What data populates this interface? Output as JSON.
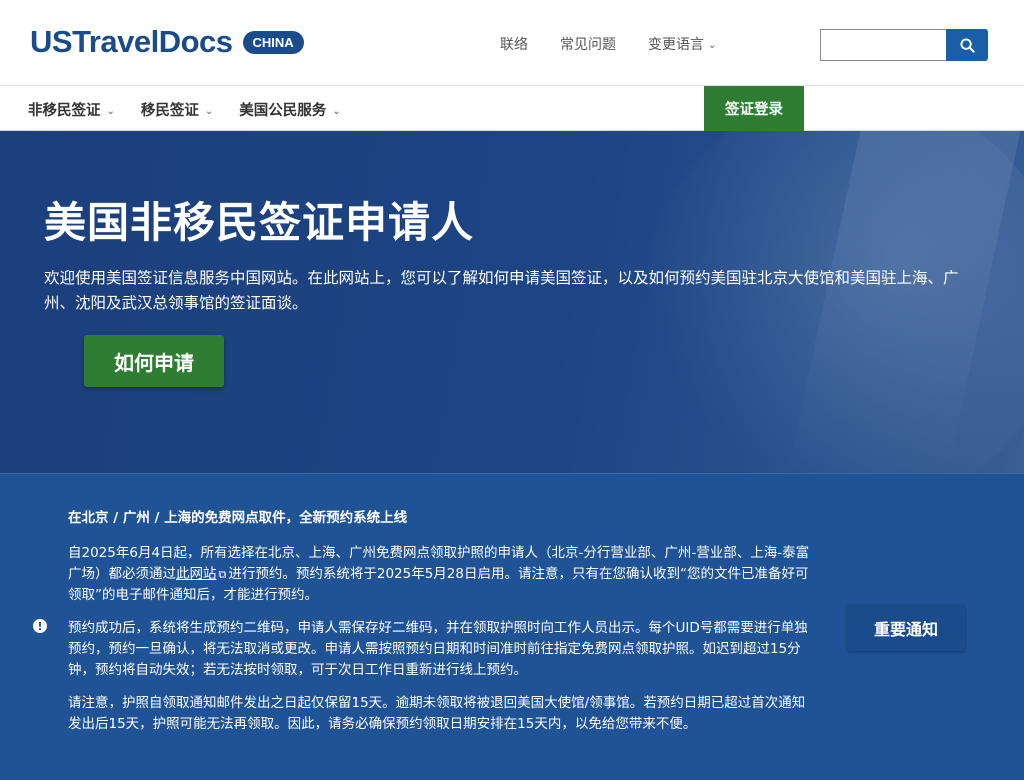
{
  "header": {
    "logo_text": "USTravelDocs",
    "logo_badge": "CHINA",
    "links": {
      "contact": "联络",
      "faq": "常见问题",
      "language": "变更语言"
    },
    "search_placeholder": ""
  },
  "nav": {
    "items": [
      {
        "label": "非移民签证"
      },
      {
        "label": "移民签证"
      },
      {
        "label": "美国公民服务"
      }
    ],
    "login_label": "签证登录"
  },
  "hero": {
    "title": "美国非移民签证申请人",
    "description": "欢迎使用美国签证信息服务中国网站。在此网站上，您可以了解如何申请美国签证，以及如何预约美国驻北京大使馆和美国驻上海、广州、沈阳及武汉总领事馆的签证面谈。",
    "apply_label": "如何申请"
  },
  "notice": {
    "heading": "在北京 / 广州 / 上海的免费网点取件，全新预约系统上线",
    "p1_before": "自2025年6月4日起，所有选择在北京、上海、广州免费网点领取护照的申请人（北京-分行营业部、广州-营业部、上海-泰富广场）都必须通过",
    "p1_link": "此网站",
    "p1_after": "进行预约。预约系统将于2025年5月28日启用。请注意，只有在您确认收到“您的文件已准备好可领取”的电子邮件通知后，才能进行预约。",
    "p2": "预约成功后，系统将生成预约二维码，申请人需保存好二维码，并在领取护照时向工作人员出示。每个UID号都需要进行单独预约，预约一旦确认，将无法取消或更改。申请人需按照预约日期和时间准时前往指定免费网点领取护照。如迟到超过15分钟，预约将自动失效；若无法按时领取，可于次日工作日重新进行线上预约。",
    "p3": "请注意，护照自领取通知邮件发出之日起仅保留15天。逾期未领取将被退回美国大使馆/领事馆。若预约日期已超过首次通知发出后15天，护照可能无法再领取。因此，请务必确保预约领取日期安排在15天内，以免给您带来不便。",
    "button_label": "重要通知",
    "icon": "exclamation-icon"
  },
  "colors": {
    "brand": "#1a4c8b",
    "green": "#2e7d32",
    "notice_bg": "#1f5396"
  }
}
